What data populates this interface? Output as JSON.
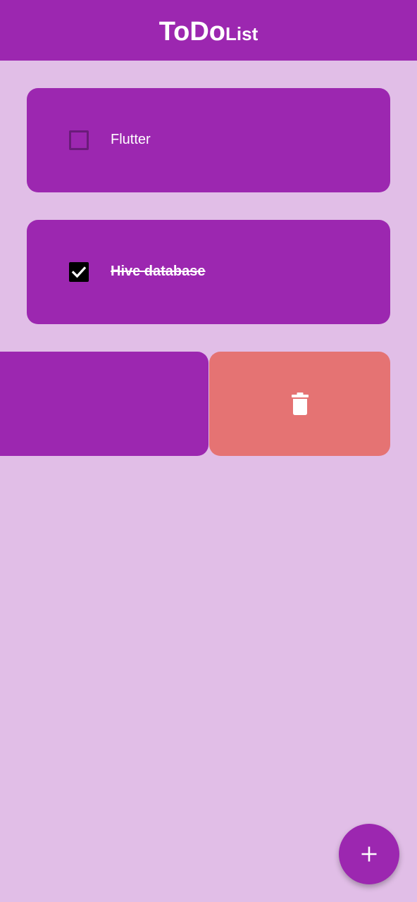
{
  "app_bar": {
    "title_main": "ToDo",
    "title_sub": "List"
  },
  "tasks": [
    {
      "label": "Flutter",
      "completed": false
    },
    {
      "label": "Hive database",
      "completed": true
    }
  ],
  "swipe_action": {
    "icon": "trash-icon"
  },
  "fab": {
    "icon": "plus-icon"
  },
  "colors": {
    "primary": "#9c27b0",
    "background": "#e1bee7",
    "delete": "#e57373",
    "text": "#ffffff"
  }
}
